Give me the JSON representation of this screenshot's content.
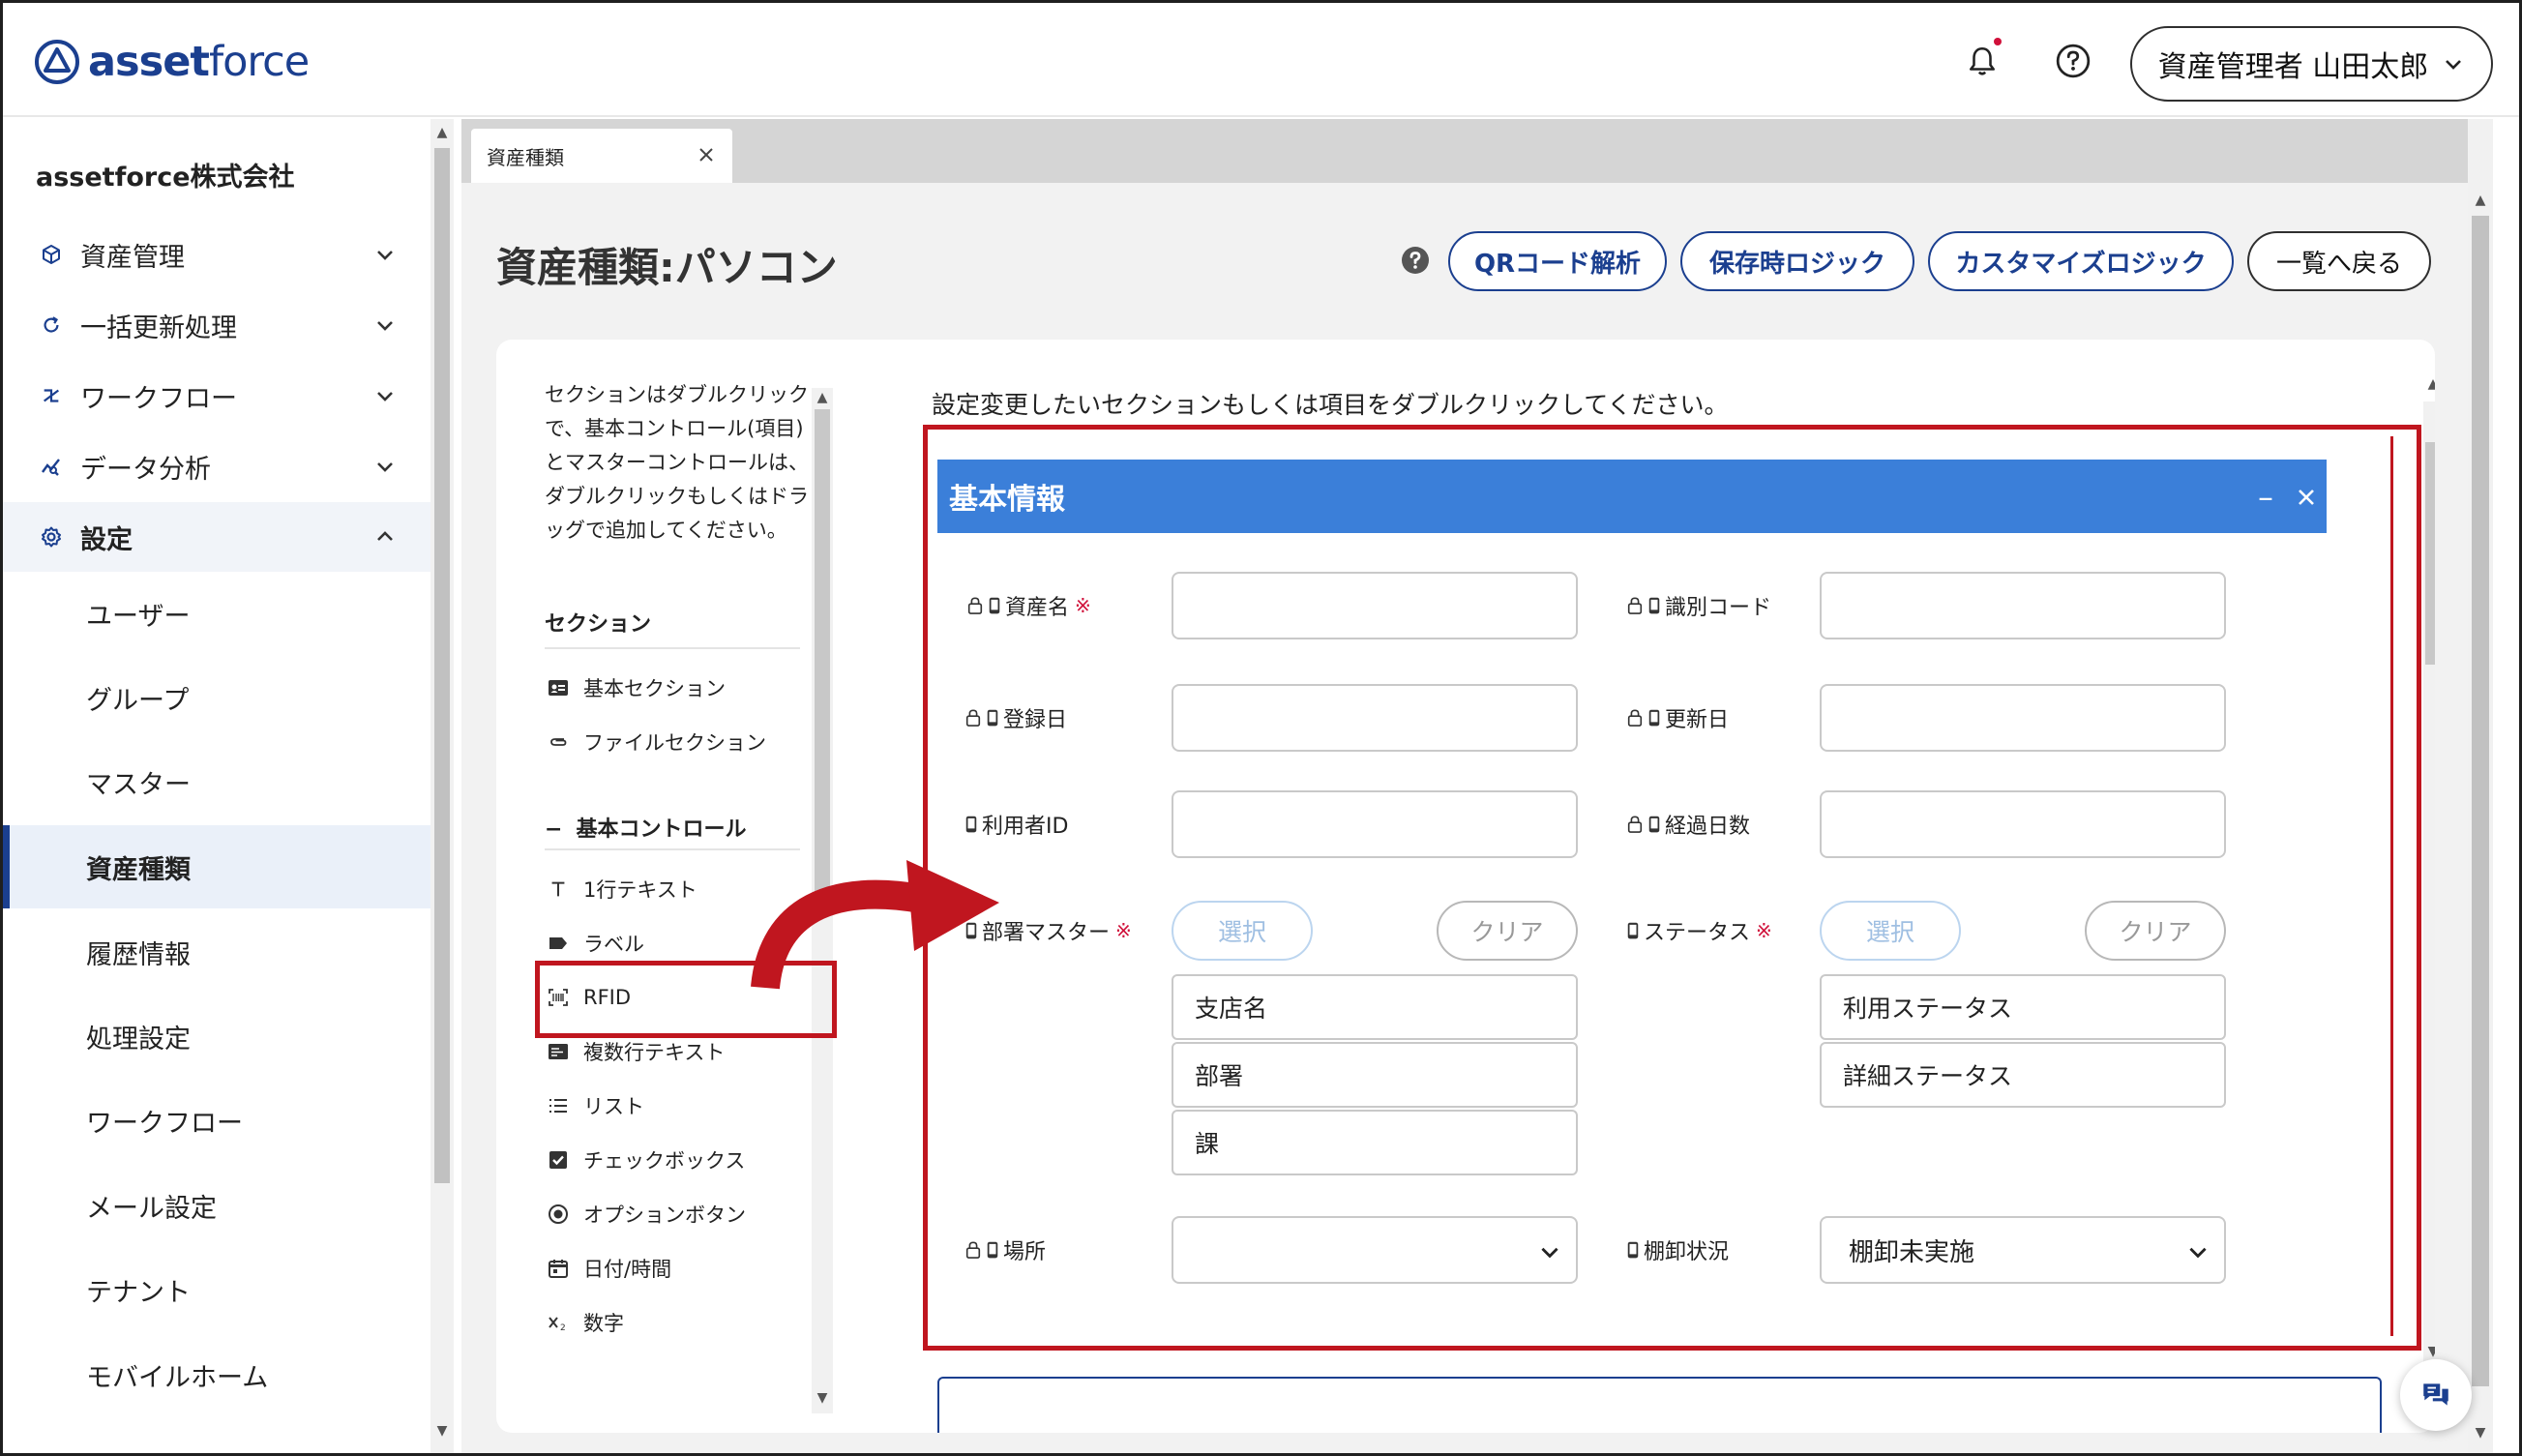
{
  "brand": {
    "name_bold": "asset",
    "name_light": "force"
  },
  "header": {
    "user_label": "資産管理者 山田太郎"
  },
  "sidebar": {
    "company": "assetforce株式会社",
    "menu": [
      {
        "label": "資産管理",
        "icon": "cube-icon"
      },
      {
        "label": "一括更新処理",
        "icon": "refresh-icon"
      },
      {
        "label": "ワークフロー",
        "icon": "workflow-icon"
      },
      {
        "label": "データ分析",
        "icon": "chart-icon"
      },
      {
        "label": "設定",
        "icon": "gear-icon"
      }
    ],
    "settings_items": [
      "ユーザー",
      "グループ",
      "マスター",
      "資産種類",
      "履歴情報",
      "処理設定",
      "ワークフロー",
      "メール設定",
      "テナント",
      "モバイルホーム"
    ],
    "active_item": "資産種類"
  },
  "tab": {
    "label": "資産種類"
  },
  "page": {
    "title": "資産種類:パソコン",
    "buttons": {
      "qr": "QRコード解析",
      "save_logic": "保存時ロジック",
      "custom_logic": "カスタマイズロジック",
      "back": "一覧へ戻る"
    }
  },
  "palette": {
    "instruction": "セクションはダブルクリックで、基本コントロール(項目)とマスターコントロールは、ダブルクリックもしくはドラッグで追加してください。",
    "section_header": "セクション",
    "sections": [
      {
        "label": "基本セクション",
        "icon": "id-card-icon"
      },
      {
        "label": "ファイルセクション",
        "icon": "paperclip-icon"
      }
    ],
    "controls_header": "基本コントロール",
    "controls_toggle": "−",
    "controls": [
      {
        "label": "1行テキスト",
        "icon": "text-icon"
      },
      {
        "label": "ラベル",
        "icon": "tag-icon"
      },
      {
        "label": "RFID",
        "icon": "rfid-icon"
      },
      {
        "label": "複数行テキスト",
        "icon": "multiline-icon"
      },
      {
        "label": "リスト",
        "icon": "list-icon"
      },
      {
        "label": "チェックボックス",
        "icon": "checkbox-icon"
      },
      {
        "label": "オプションボタン",
        "icon": "radio-icon"
      },
      {
        "label": "日付/時間",
        "icon": "calendar-icon"
      },
      {
        "label": "数字",
        "icon": "number-icon"
      }
    ]
  },
  "form": {
    "instruction": "設定変更したいセクションもしくは項目をダブルクリックしてください。",
    "section_title": "基本情報",
    "required_mark": "※",
    "fields": {
      "asset_name": "資産名",
      "id_code": "識別コード",
      "registered_date": "登録日",
      "updated_date": "更新日",
      "user_id": "利用者ID",
      "elapsed_days": "経過日数",
      "dept_master": "部署マスター",
      "status": "ステータス",
      "location": "場所",
      "inventory_status": "棚卸状況"
    },
    "select_label": "選択",
    "clear_label": "クリア",
    "dept_subfields": [
      "支店名",
      "部署",
      "課"
    ],
    "status_subfields": [
      "利用ステータス",
      "詳細ステータス"
    ],
    "location_value": "",
    "inventory_value": "棚卸未実施"
  },
  "colors": {
    "brand": "#1b3f8f",
    "section_header": "#3b7fd9",
    "highlight": "#c0161f",
    "required": "#d0103a"
  }
}
